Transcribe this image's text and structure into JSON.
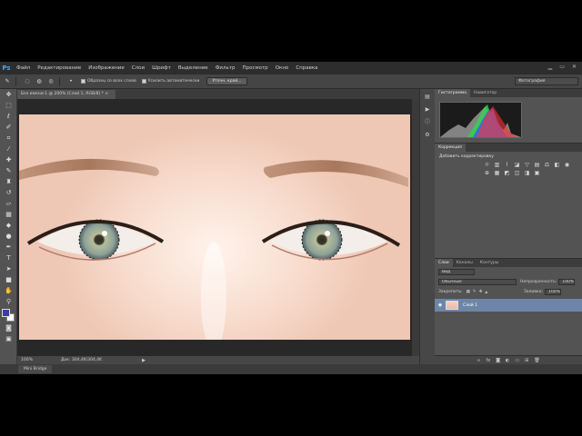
{
  "app": {
    "logo": "Ps"
  },
  "menu": [
    "Файл",
    "Редактирование",
    "Изображение",
    "Слои",
    "Шрифт",
    "Выделение",
    "Фильтр",
    "Просмотр",
    "Окно",
    "Справка"
  ],
  "options": {
    "sample_all_layers": "Образец со всех слоев",
    "auto_enhance": "Усилить автоматически",
    "refine_edge": "Уточн. край...",
    "workspace": "Фотография"
  },
  "document": {
    "tab_title": "Без имени-1 @ 200% (Слой 1, RGB/8) *"
  },
  "status": {
    "zoom": "100%",
    "doc_size": "Док: 304,4K/304,4K",
    "mini_bridge": "Mini Bridge"
  },
  "panels": {
    "histogram_tabs": [
      "Гистограмма",
      "Навигатор"
    ],
    "adjustments_tab": "Коррекция",
    "adjustments_sub": "Добавить корректировку",
    "layers_tabs": [
      "Слои",
      "Каналы",
      "Контуры"
    ],
    "layers_kind": "Вид",
    "blend_mode": "Обычные",
    "opacity_label": "Непрозрачность:",
    "opacity_value": "100%",
    "lock_label": "Закрепить:",
    "fill_label": "Заливка:",
    "fill_value": "100%",
    "layer_name": "Слой 1"
  },
  "icons": {
    "tools": [
      "move-icon",
      "marquee-icon",
      "lasso-icon",
      "quick-selection-icon",
      "crop-icon",
      "eyedropper-icon",
      "healing-brush-icon",
      "brush-icon",
      "clone-stamp-icon",
      "history-brush-icon",
      "eraser-icon",
      "gradient-icon",
      "blur-icon",
      "dodge-icon",
      "pen-icon",
      "type-icon",
      "path-selection-icon",
      "rectangle-icon",
      "hand-icon",
      "zoom-icon"
    ]
  },
  "colors": {
    "foreground": "#3a3fa8",
    "background": "#ffffff",
    "layer_selected": "#6d86a8",
    "ps_blue": "#4fa3e8"
  }
}
